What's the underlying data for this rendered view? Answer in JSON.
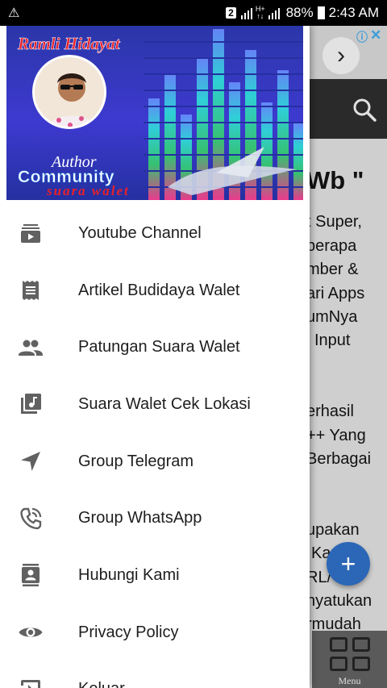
{
  "status_bar": {
    "sim_slot": "2",
    "network_type_top": "H+",
    "network_type_bottom": "↑↓",
    "battery_percent": "88%",
    "time": "2:43 AM"
  },
  "drawer": {
    "banner": {
      "owner_name": "Ramli Hidayat",
      "author_label": "Author",
      "community_text": "Community",
      "community_subtitle": "suara walet"
    },
    "items": [
      {
        "label": "Youtube Channel",
        "icon": "youtube-channel-icon"
      },
      {
        "label": "Artikel Budidaya Walet",
        "icon": "article-icon"
      },
      {
        "label": "Patungan Suara Walet",
        "icon": "people-icon"
      },
      {
        "label": "Suara Walet Cek Lokasi",
        "icon": "music-library-icon"
      },
      {
        "label": "Group Telegram",
        "icon": "navigation-arrow-icon"
      },
      {
        "label": "Group WhatsApp",
        "icon": "phone-in-talk-icon"
      },
      {
        "label": "Hubungi Kami",
        "icon": "contact-card-icon"
      },
      {
        "label": "Privacy Policy",
        "icon": "eye-icon"
      },
      {
        "label": "Keluar",
        "icon": "exit-icon"
      }
    ]
  },
  "background_app": {
    "heading_fragment": "Wb \"",
    "text_lines": [
      "t Super,",
      "berapa",
      "mber &",
      "ari Apps",
      "umNya",
      "Input",
      "",
      "erhasil",
      "++ Yang",
      "Berbagai",
      "",
      "upakan",
      "Ka",
      "RL/",
      "nyatukan",
      "rmudah"
    ],
    "menu_label": "Menu",
    "colors": {
      "accent": "#2b67b6",
      "toolbar": "#2a2a2a"
    }
  }
}
